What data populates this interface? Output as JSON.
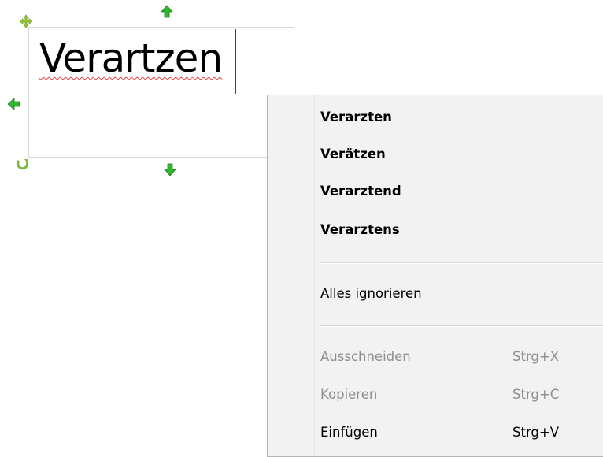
{
  "textbox": {
    "text": "Verartzen"
  },
  "context_menu": {
    "suggestions": [
      {
        "label": "Verarzten"
      },
      {
        "label": "Verätzen"
      },
      {
        "label": "Verarztend"
      },
      {
        "label": "Verarztens"
      }
    ],
    "ignore_all_label": "Alles ignorieren",
    "actions": [
      {
        "label": "Ausschneiden",
        "shortcut": "Strg+X",
        "enabled": false
      },
      {
        "label": "Kopieren",
        "shortcut": "Strg+C",
        "enabled": false
      },
      {
        "label": "Einfügen",
        "shortcut": "Strg+V",
        "enabled": true
      }
    ]
  },
  "colors": {
    "handle_green": "#2db82d",
    "spellcheck_underline": "#e8413b",
    "menu_background": "#f2f2f2",
    "disabled_text": "#8e8e8e"
  },
  "icons": {
    "move_handle": "move-icon",
    "top_handle": "arrow-up-icon",
    "left_handle": "arrow-left-icon",
    "bottom_handle": "arrow-down-icon",
    "rotate_handle": "rotate-icon"
  }
}
